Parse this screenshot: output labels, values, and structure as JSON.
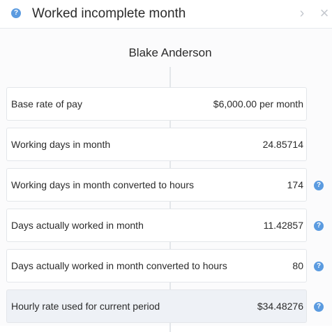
{
  "header": {
    "title": "Worked incomplete month",
    "help_icon": "?",
    "next_icon": "›",
    "close_icon": "×"
  },
  "employee_name": "Blake Anderson",
  "rows": [
    {
      "label": "Base rate of pay",
      "value": "$6,000.00 per month",
      "has_help": false,
      "highlight": false
    },
    {
      "label": "Working days in month",
      "value": "24.85714",
      "has_help": false,
      "highlight": false
    },
    {
      "label": "Working days in month converted to hours",
      "value": "174",
      "has_help": true,
      "highlight": false
    },
    {
      "label": "Days actually worked in month",
      "value": "11.42857",
      "has_help": true,
      "highlight": false
    },
    {
      "label": "Days actually worked in month converted to hours",
      "value": "80",
      "has_help": true,
      "highlight": false
    },
    {
      "label": "Hourly rate used for current period",
      "value": "$34.48276",
      "has_help": true,
      "highlight": true
    }
  ],
  "row_help_icon": "?",
  "colors": {
    "accent": "#5b9be0",
    "border": "#e3e6ea",
    "highlight_row": "#eef1f6"
  }
}
